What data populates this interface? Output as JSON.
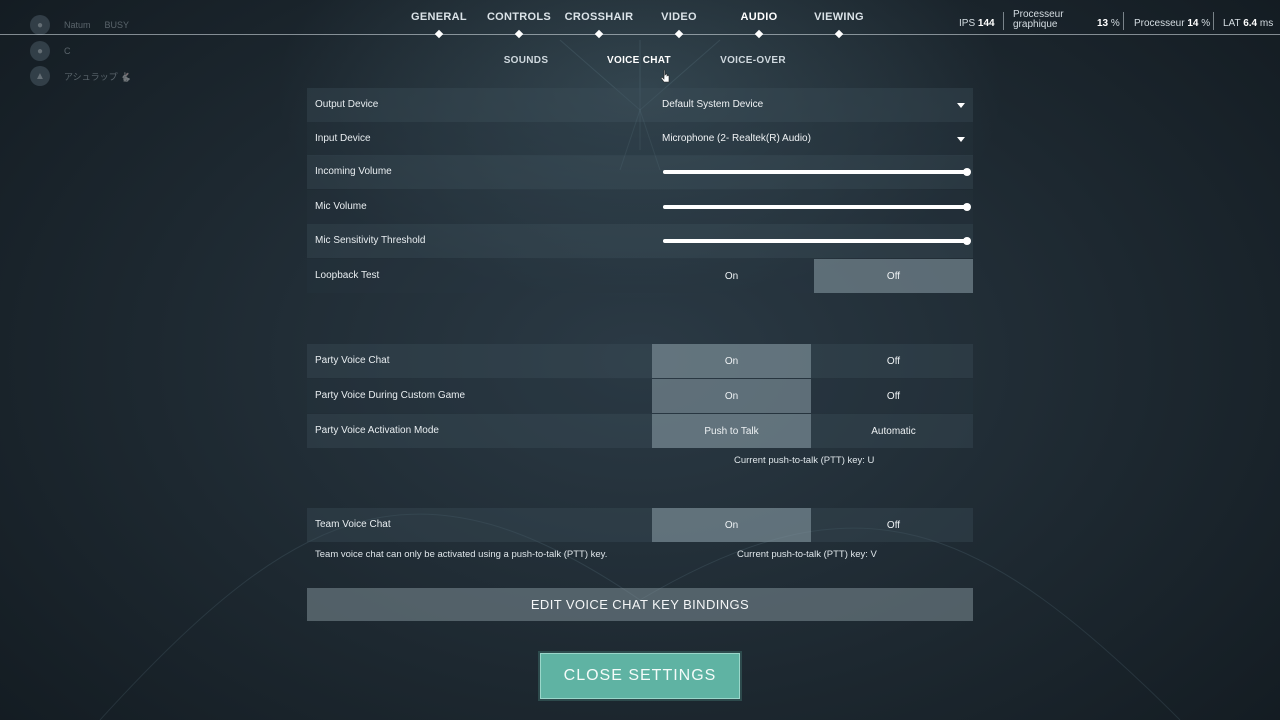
{
  "nav": {
    "tabs": [
      {
        "label": "GENERAL"
      },
      {
        "label": "CONTROLS"
      },
      {
        "label": "CROSSHAIR"
      },
      {
        "label": "VIDEO"
      },
      {
        "label": "AUDIO"
      },
      {
        "label": "VIEWING"
      }
    ],
    "active": "AUDIO"
  },
  "user": {
    "rows": [
      {
        "name": "Natum",
        "status": "BUSY"
      },
      {
        "name": "C",
        "status": ""
      },
      {
        "name": "アシュラップ 🐇",
        "status": ""
      }
    ]
  },
  "perf": {
    "ips_label": "IPS",
    "ips_value": "144",
    "gpu_label_1": "Processeur",
    "gpu_label_2": "graphique",
    "gpu_value": "13",
    "gpu_unit": "%",
    "cpu_label": "Processeur",
    "cpu_value": "14",
    "cpu_unit": "%",
    "lat_label": "LAT",
    "lat_value": "6.4",
    "lat_unit": "ms"
  },
  "subtabs": [
    {
      "label": "SOUNDS"
    },
    {
      "label": "VOICE CHAT"
    },
    {
      "label": "VOICE-OVER"
    }
  ],
  "settings": {
    "output_device": {
      "label": "Output Device",
      "value": "Default System Device"
    },
    "input_device": {
      "label": "Input Device",
      "value": "Microphone (2- Realtek(R) Audio)"
    },
    "incoming_volume": {
      "label": "Incoming Volume",
      "level": 1.0
    },
    "mic_volume": {
      "label": "Mic Volume",
      "level": 1.0
    },
    "mic_threshold": {
      "label": "Mic Sensitivity Threshold",
      "level": 1.0
    },
    "loopback": {
      "label": "Loopback Test",
      "on": "On",
      "off": "Off",
      "selected": "off"
    },
    "party_voice": {
      "label": "Party Voice Chat",
      "on": "On",
      "off": "Off",
      "selected": "on"
    },
    "party_custom": {
      "label": "Party Voice During Custom Game",
      "on": "On",
      "off": "Off",
      "selected": "on"
    },
    "party_mode": {
      "label": "Party Voice Activation Mode",
      "on": "Push to Talk",
      "off": "Automatic",
      "selected": "on"
    },
    "party_ptt_hint": "Current push-to-talk (PTT) key: U",
    "team_voice": {
      "label": "Team Voice Chat",
      "on": "On",
      "off": "Off",
      "selected": "on"
    },
    "team_hint": "Team voice chat can only be activated using a push-to-talk (PTT) key.",
    "team_ptt_hint": "Current push-to-talk (PTT) key: V"
  },
  "buttons": {
    "edit": "EDIT VOICE CHAT KEY BINDINGS",
    "close": "CLOSE SETTINGS"
  }
}
